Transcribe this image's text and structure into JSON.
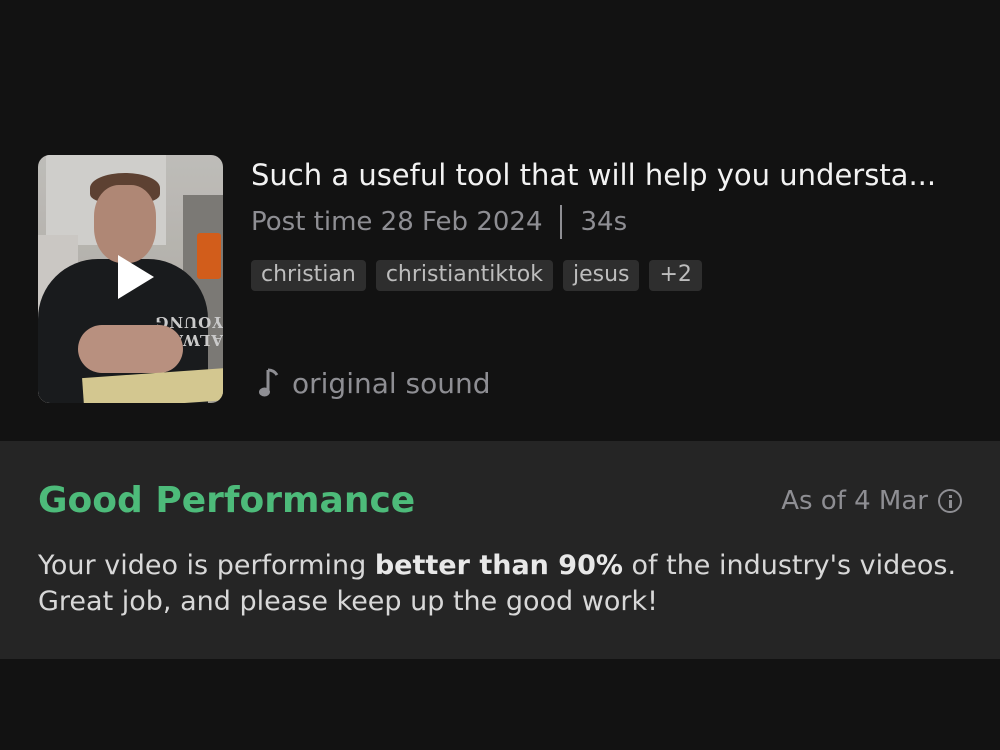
{
  "video": {
    "title": "Such a useful tool that will help you understa...",
    "post_time_label": "Post time 28 Feb 2024",
    "duration": "34s",
    "tags": [
      "christian",
      "christiantiktok",
      "jesus",
      "+2"
    ],
    "sound": "original sound",
    "thumbnail_print": "ALWAYS YOUNG",
    "play_icon": "play-icon",
    "sound_icon": "music-note-icon"
  },
  "performance": {
    "title": "Good Performance",
    "as_of": "As of 4 Mar",
    "info_icon": "info-icon",
    "desc_before": "Your video is performing ",
    "desc_bold": "better than 90%",
    "desc_after": " of the industry's videos. Great job, and please keep up the good work!",
    "accent_color": "#4dbb7a"
  }
}
